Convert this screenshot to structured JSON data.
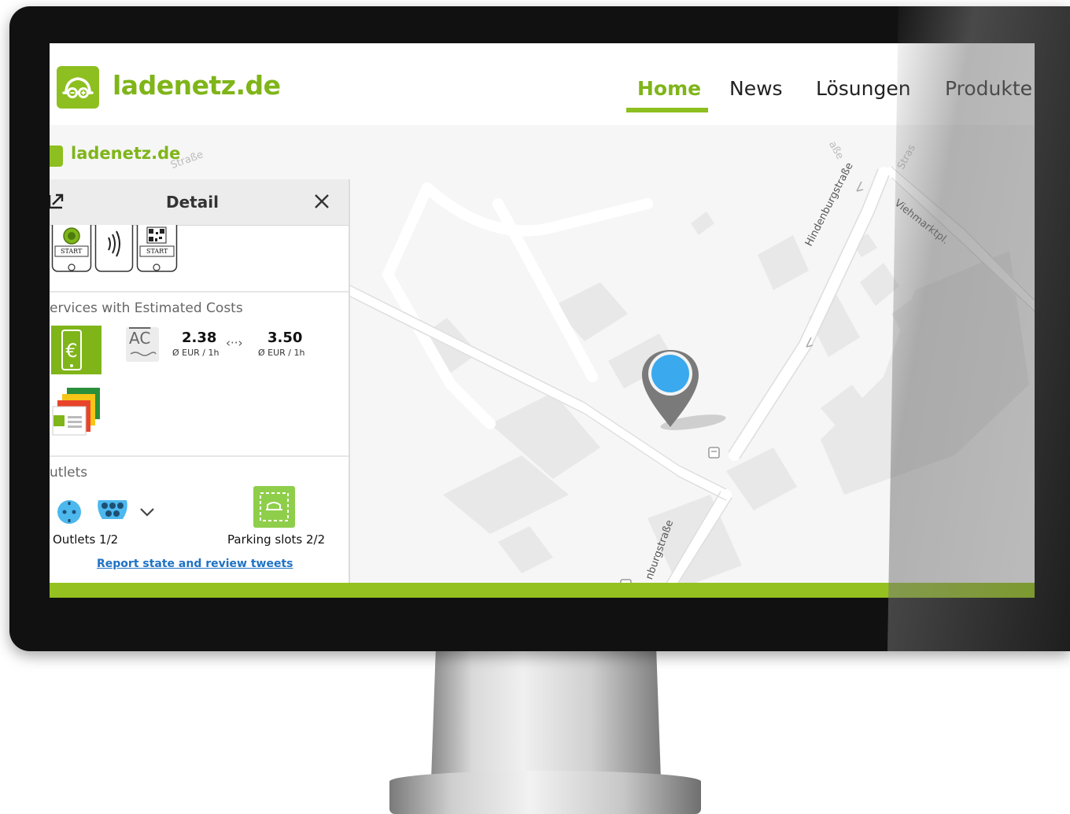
{
  "site": {
    "logo_text": "ladenetz.de",
    "nav": [
      {
        "label": "Home",
        "active": true
      },
      {
        "label": "News",
        "active": false
      },
      {
        "label": "Lösungen",
        "active": false
      },
      {
        "label": "Produkte",
        "active": false
      }
    ],
    "brand_color": "#8cbf1f"
  },
  "map": {
    "logo_text": "ladenetz.de",
    "streets": [
      "Hindenburgstraße",
      "Viehmarktpl.",
      "nburgstraße",
      "Straße",
      "aße",
      "Stras"
    ],
    "marker_color": "#3aa9ee"
  },
  "detail": {
    "title": "Detail",
    "auth_icons": [
      {
        "name": "start-app-icon",
        "label": "START"
      },
      {
        "name": "rfid-icon",
        "label": ")))"
      },
      {
        "name": "qr-start-icon",
        "label": "START"
      }
    ],
    "services_label": "ervices with Estimated Costs",
    "ac_label": "AC",
    "price_min": "2.38",
    "price_max": "3.50",
    "price_unit": "Ø EUR / 1h",
    "range_glyph": "‹··›",
    "outlets_label": "utlets",
    "outlets_caption": "Outlets 1/2",
    "parking_caption": "Parking slots 2/2",
    "report_link": "Report state and review tweets"
  }
}
